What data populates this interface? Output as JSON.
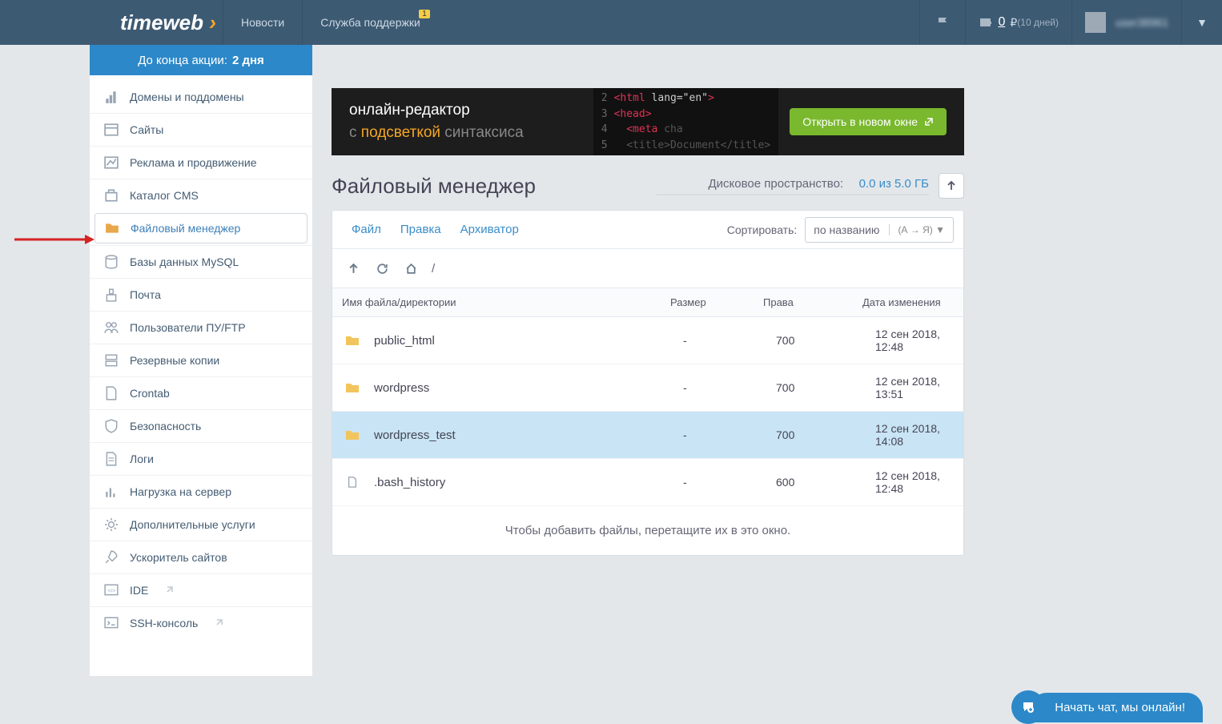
{
  "header": {
    "logo": "timeweb",
    "nav": {
      "news": "Новости",
      "support": "Служба поддержки",
      "support_badge": "1"
    },
    "balance": {
      "amount": "0",
      "currency": "₽",
      "days": "(10 дней)"
    },
    "user": "user38961"
  },
  "promo": {
    "text": "До конца акции:",
    "days": "2 дня"
  },
  "sidebar": {
    "items": [
      "Домены и поддомены",
      "Сайты",
      "Реклама и продвижение",
      "Каталог CMS",
      "Файловый менеджер",
      "Базы данных MySQL",
      "Почта",
      "Пользователи ПУ/FTP",
      "Резервные копии",
      "Crontab",
      "Безопасность",
      "Логи",
      "Нагрузка на сервер",
      "Дополнительные услуги",
      "Ускоритель сайтов",
      "IDE",
      "SSH-консоль"
    ]
  },
  "banner": {
    "line1": "онлайн-редактор",
    "line2_pre": "с ",
    "line2_hl": "подсветкой",
    "line2_post": " синтаксиса",
    "button": "Открыть в новом окне"
  },
  "page": {
    "title": "Файловый менеджер"
  },
  "disk": {
    "label": "Дисковое пространство:",
    "value": "0.0 из 5.0 ГБ"
  },
  "tabs": {
    "file": "Файл",
    "edit": "Правка",
    "archive": "Архиватор"
  },
  "sort": {
    "label": "Сортировать:",
    "value": "по названию",
    "dir": "(А → Я)"
  },
  "breadcrumb": {
    "path": "/"
  },
  "table": {
    "headers": {
      "name": "Имя файла/директории",
      "size": "Размер",
      "rights": "Права",
      "date": "Дата изменения"
    },
    "rows": [
      {
        "type": "folder",
        "name": "public_html",
        "size": "-",
        "rights": "700",
        "date": "12 сен 2018, 12:48"
      },
      {
        "type": "folder",
        "name": "wordpress",
        "size": "-",
        "rights": "700",
        "date": "12 сен 2018, 13:51"
      },
      {
        "type": "folder",
        "name": "wordpress_test",
        "size": "-",
        "rights": "700",
        "date": "12 сен 2018, 14:08",
        "selected": true
      },
      {
        "type": "file",
        "name": ".bash_history",
        "size": "-",
        "rights": "600",
        "date": "12 сен 2018, 12:48"
      }
    ],
    "hint": "Чтобы добавить файлы, перетащите их в это окно."
  },
  "chat": {
    "label": "Начать чат, мы онлайн!"
  }
}
